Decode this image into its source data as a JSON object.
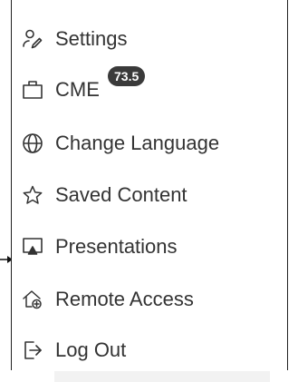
{
  "menu": {
    "items": [
      {
        "label": "Settings",
        "icon": "user-settings-icon"
      },
      {
        "label": "CME",
        "icon": "briefcase-icon",
        "badge": "73.5"
      },
      {
        "label": "Change Language",
        "icon": "globe-icon"
      },
      {
        "label": "Saved Content",
        "icon": "star-icon"
      },
      {
        "label": "Presentations",
        "icon": "presentation-icon"
      },
      {
        "label": "Remote Access",
        "icon": "remote-home-icon"
      },
      {
        "label": "Log Out",
        "icon": "logout-icon"
      }
    ]
  },
  "colors": {
    "text": "#333333",
    "icon": "#333333",
    "badge_bg": "#3a3a3a",
    "badge_text": "#ffffff",
    "border": "#222222"
  }
}
